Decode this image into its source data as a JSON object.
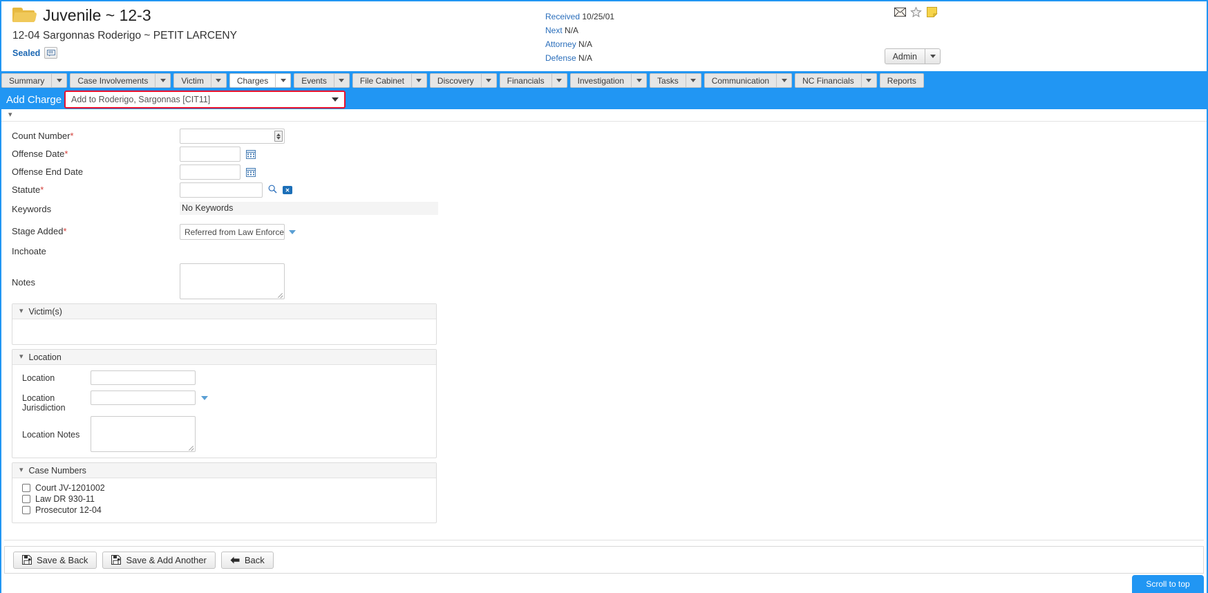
{
  "header": {
    "case_title": "Juvenile ~ 12-3",
    "case_subtitle": "12-04 Sargonnas Roderigo ~ PETIT LARCENY",
    "sealed_label": "Sealed",
    "meta": [
      {
        "key": "Received",
        "value": "10/25/01"
      },
      {
        "key": "Next",
        "value": "N/A"
      },
      {
        "key": "Attorney",
        "value": "N/A"
      },
      {
        "key": "Defense",
        "value": "N/A"
      }
    ],
    "icons": [
      "envelope-icon",
      "star-icon",
      "sticky-note-icon"
    ],
    "admin_label": "Admin"
  },
  "nav": {
    "tabs": [
      {
        "label": "Summary",
        "caret": true,
        "active": false
      },
      {
        "label": "Case Involvements",
        "caret": true,
        "active": false
      },
      {
        "label": "Victim",
        "caret": true,
        "active": false
      },
      {
        "label": "Charges",
        "caret": true,
        "active": true
      },
      {
        "label": "Events",
        "caret": true,
        "active": false
      },
      {
        "label": "File Cabinet",
        "caret": true,
        "active": false
      },
      {
        "label": "Discovery",
        "caret": true,
        "active": false
      },
      {
        "label": "Financials",
        "caret": true,
        "active": false
      },
      {
        "label": "Investigation",
        "caret": true,
        "active": false
      },
      {
        "label": "Tasks",
        "caret": true,
        "active": false
      },
      {
        "label": "Communication",
        "caret": true,
        "active": false
      },
      {
        "label": "NC Financials",
        "caret": true,
        "active": false
      },
      {
        "label": "Reports",
        "caret": false,
        "active": false
      }
    ]
  },
  "add_charge": {
    "label": "Add Charge",
    "help_icon": "question-mark-icon",
    "selected_option": "Add to Roderigo, Sargonnas [CIT11]",
    "highlight_color": "#e8112d"
  },
  "form": {
    "count_number": {
      "label": "Count Number",
      "required": true,
      "value": ""
    },
    "offense_date": {
      "label": "Offense Date",
      "required": true,
      "value": ""
    },
    "offense_end_date": {
      "label": "Offense End Date",
      "required": false,
      "value": ""
    },
    "statute": {
      "label": "Statute",
      "required": true,
      "value": ""
    },
    "keywords": {
      "label": "Keywords",
      "value": "No Keywords"
    },
    "stage_added": {
      "label": "Stage Added",
      "required": true,
      "value": "Referred from Law Enforcemen"
    },
    "inchoate": {
      "label": "Inchoate",
      "value": ""
    },
    "notes": {
      "label": "Notes",
      "value": ""
    }
  },
  "victims_panel": {
    "title": "Victim(s)"
  },
  "location_panel": {
    "title": "Location",
    "fields": [
      {
        "label": "Location",
        "value": "",
        "type": "text"
      },
      {
        "label": "Location Jurisdiction",
        "value": "",
        "type": "combo"
      },
      {
        "label": "Location Notes",
        "value": "",
        "type": "textarea"
      }
    ]
  },
  "case_numbers_panel": {
    "title": "Case Numbers",
    "items": [
      {
        "label": "Court JV-1201002",
        "checked": false
      },
      {
        "label": "Law DR 930-11",
        "checked": false
      },
      {
        "label": "Prosecutor 12-04",
        "checked": false
      }
    ]
  },
  "footer": {
    "save_back": "Save & Back",
    "save_add_another": "Save & Add Another",
    "back": "Back",
    "scroll_to_top": "Scroll to top"
  },
  "colors": {
    "accent_blue": "#2196f3",
    "link_blue": "#2a6ebb",
    "highlight_red": "#e8112d"
  }
}
